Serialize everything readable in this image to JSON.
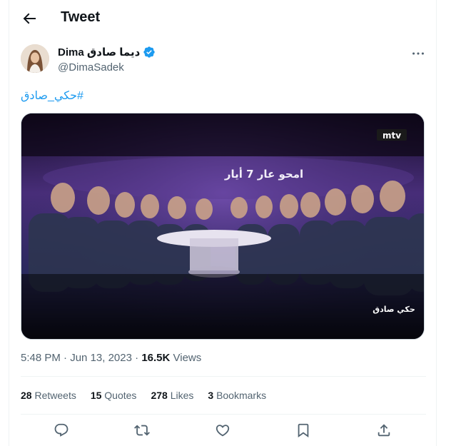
{
  "header": {
    "title": "Tweet",
    "back_icon": "arrow-left-icon"
  },
  "author": {
    "display_name": "Dima ديما صادق",
    "handle": "@DimaSadek",
    "verified": true,
    "verified_color": "#1d9bf0"
  },
  "tweet": {
    "hashtag": "#حكي_صادق",
    "media": {
      "channel_logo": "mtv",
      "banner_text": "امحو عار 7 أيار",
      "show_logo": "حكي صادق"
    },
    "time": "5:48 PM",
    "date": "Jun 13, 2023",
    "views_count": "16.5K",
    "views_label": "Views",
    "separator": "·"
  },
  "stats": {
    "retweets_count": "28",
    "retweets_label": "Retweets",
    "quotes_count": "15",
    "quotes_label": "Quotes",
    "likes_count": "278",
    "likes_label": "Likes",
    "bookmarks_count": "3",
    "bookmarks_label": "Bookmarks"
  },
  "actions": [
    "reply-icon",
    "retweet-icon",
    "like-icon",
    "bookmark-icon",
    "share-icon"
  ],
  "colors": {
    "accent": "#1d9bf0",
    "secondary_text": "#536471",
    "divider": "#eff3f4"
  }
}
